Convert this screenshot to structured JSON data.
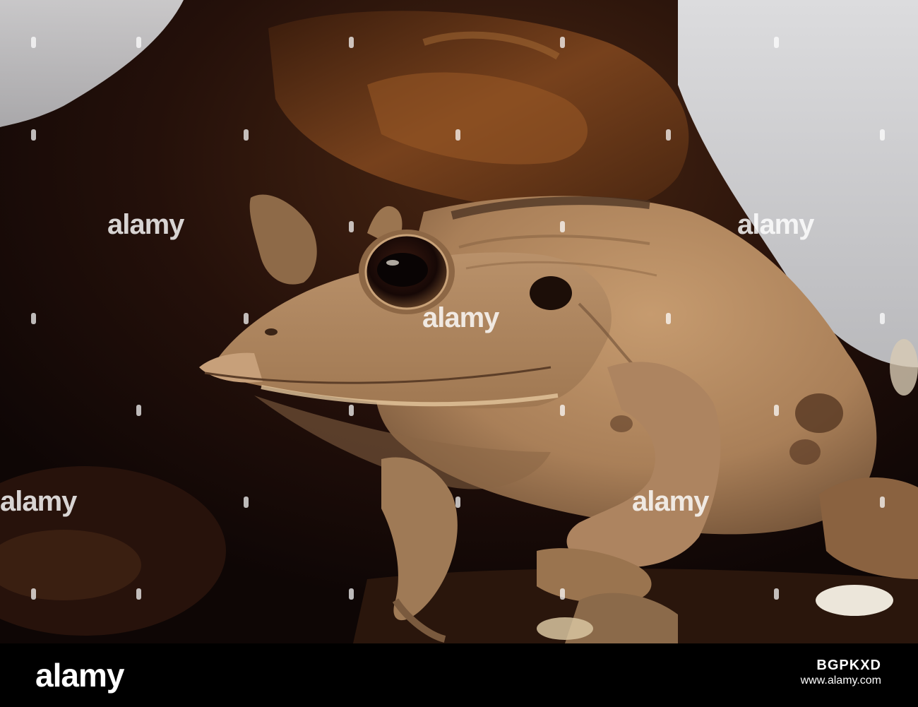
{
  "photo": {
    "subject_icon": "frog-photo",
    "palette": {
      "background_dark": "#140806",
      "bark_brown": "#5a2e14",
      "frog_tan": "#b58a61",
      "frog_shadow": "#7a5a3e",
      "eye_dark": "#1a0c08",
      "grey_backdrop": "#cfcfd2"
    }
  },
  "watermark": {
    "word": "alamy"
  },
  "footer": {
    "logo": "alamy",
    "image_id": "BGPKXD",
    "url": "www.alamy.com",
    "bar_color": "#000000"
  }
}
